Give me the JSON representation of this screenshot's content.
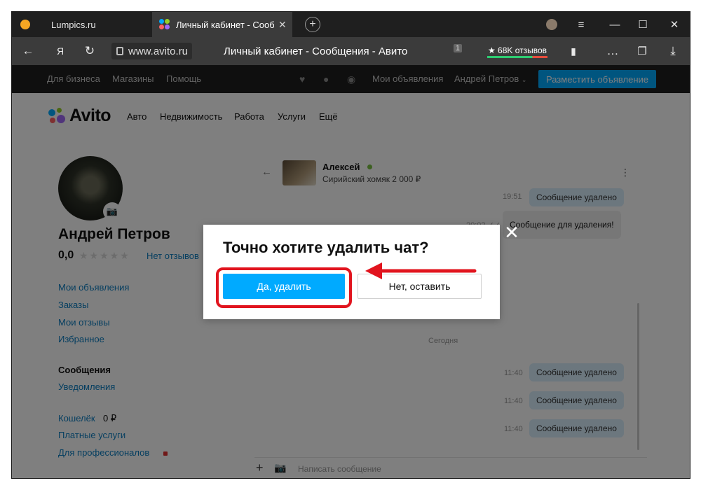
{
  "browser": {
    "tabs": [
      {
        "title": "Lumpics.ru",
        "active": false
      },
      {
        "title": "Личный кабинет - Сооб",
        "active": true
      }
    ],
    "url": "www.avito.ru",
    "page_title": "Личный кабинет - Сообщения - Авито",
    "extension_count": "1",
    "reviews_badge": "★ 68K отзывов",
    "window_controls": {
      "menu": "≡",
      "minimize": "—",
      "maximize": "☐",
      "close": "✕"
    },
    "icons": {
      "back": "←",
      "yandex": "Я",
      "reload": "↻",
      "bookmark": "▮",
      "more": "…",
      "download": "⤓"
    }
  },
  "site_header": {
    "links": [
      "Для бизнеса",
      "Магазины",
      "Помощь"
    ],
    "my_ads": "Мои объявления",
    "user": "Андрей Петров",
    "post_button": "Разместить объявление"
  },
  "logo": "Avito",
  "categories": [
    "Авто",
    "Недвижимость",
    "Работа",
    "Услуги",
    "Ещё"
  ],
  "profile": {
    "name": "Андрей Петров",
    "rating": "0,0",
    "stars": "★★★★★",
    "no_reviews": "Нет отзывов"
  },
  "sidebar": {
    "group1": [
      "Мои объявления",
      "Заказы",
      "Мои отзывы",
      "Избранное"
    ],
    "messages": "Сообщения",
    "notifications": "Уведомления",
    "wallet": "Кошелёк",
    "wallet_amount": "0 ₽",
    "paid_services": "Платные услуги",
    "for_pros": "Для профессионалов"
  },
  "chat": {
    "name": "Алексей",
    "subtitle": "Сирийский хомяк   2 000 ₽",
    "messages": [
      {
        "time": "19:51",
        "text": "Сообщение удалено"
      },
      {
        "time": "20:02 ✓✓",
        "text": "Сообщение для удаления!"
      },
      {
        "time": "11:40",
        "text": "Сообщение удалено"
      },
      {
        "time": "11:40",
        "text": "Сообщение удалено"
      },
      {
        "time": "11:40",
        "text": "Сообщение удалено"
      }
    ],
    "date_label": "Сегодня",
    "composer_placeholder": "Написать сообщение"
  },
  "modal": {
    "title": "Точно хотите удалить чат?",
    "confirm": "Да, удалить",
    "cancel": "Нет, оставить"
  },
  "colors": {
    "accent": "#00aaff",
    "annotation": "#e1141e",
    "link": "#0a7dc1"
  }
}
